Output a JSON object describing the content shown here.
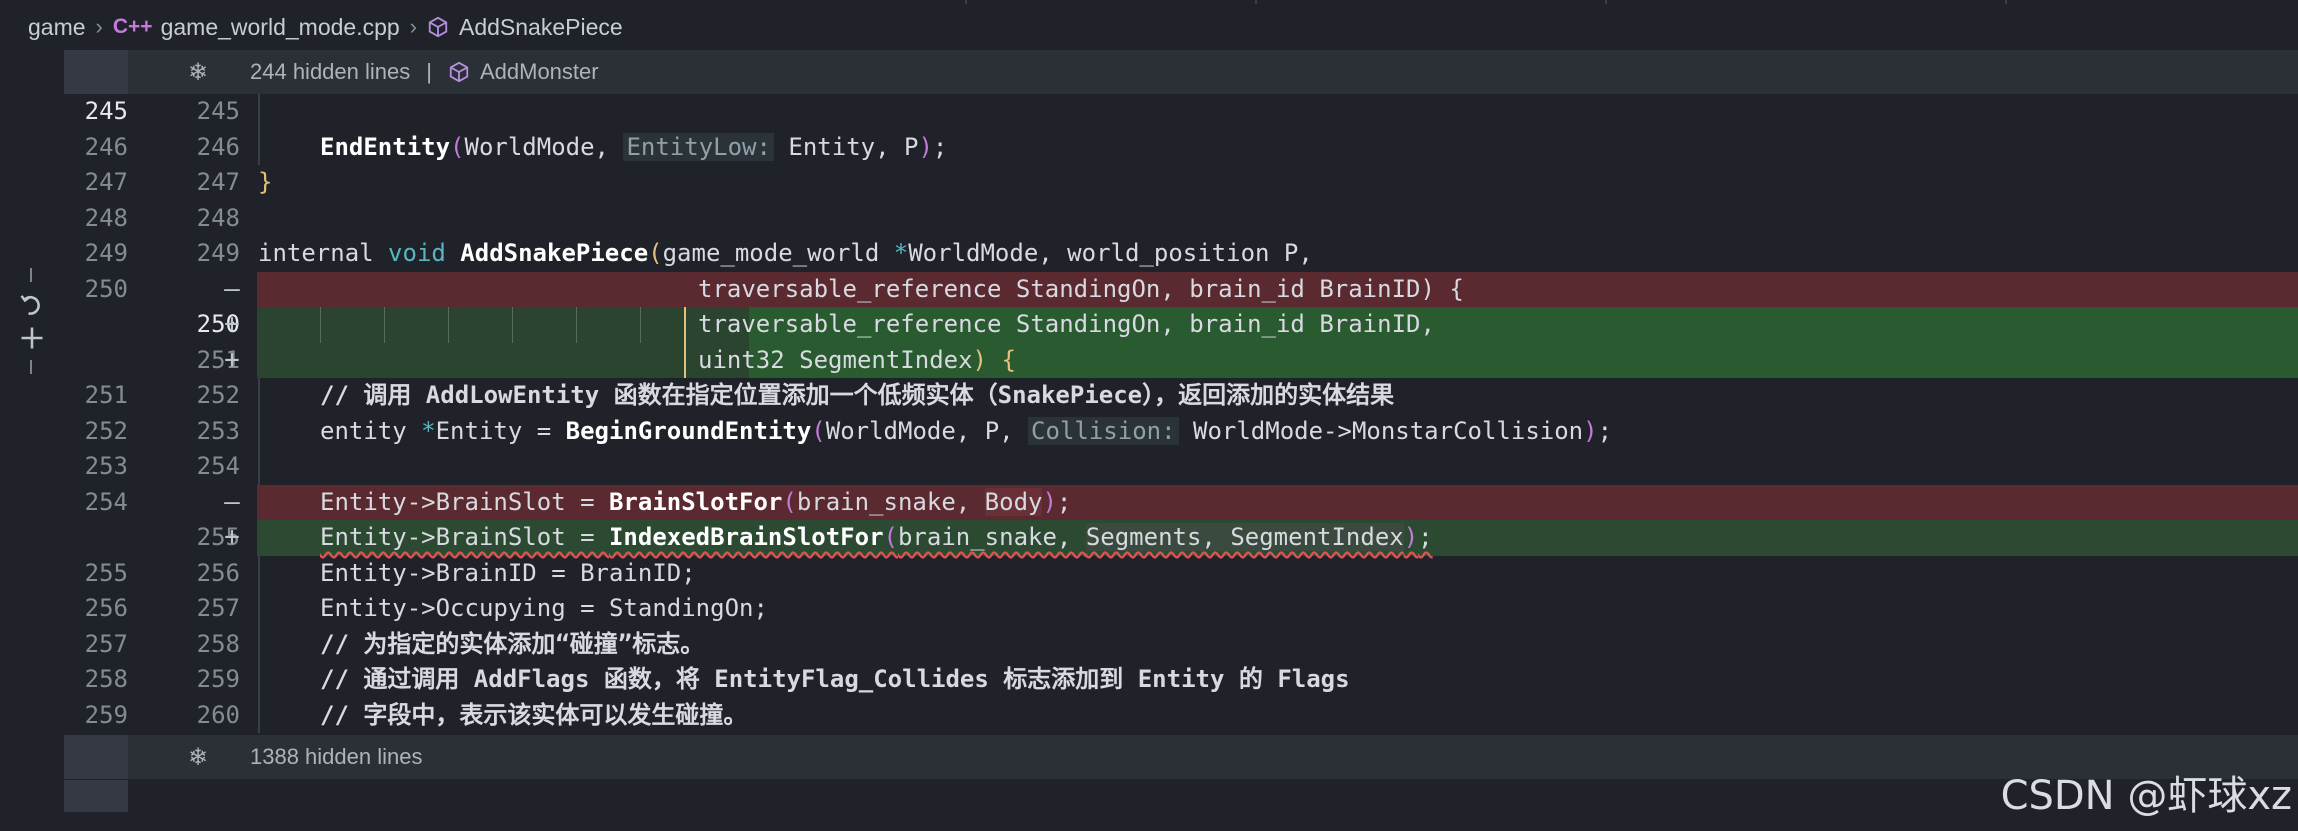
{
  "breadcrumb": {
    "folder": "game",
    "file_badge": "C++",
    "file": "game_world_mode.cpp",
    "symbol": "AddSnakePiece"
  },
  "fold_top": {
    "count": "244 hidden lines",
    "separator": "|",
    "symbol": "AddMonster"
  },
  "fold_bottom": {
    "count": "1388 hidden lines"
  },
  "lines": [
    {
      "old": "245",
      "new": "245",
      "type": "context",
      "active": true
    },
    {
      "old": "246",
      "new": "246",
      "type": "context"
    },
    {
      "old": "247",
      "new": "247",
      "type": "context"
    },
    {
      "old": "248",
      "new": "248",
      "type": "context"
    },
    {
      "old": "249",
      "new": "249",
      "type": "context"
    },
    {
      "old": "250",
      "new": "",
      "type": "removed",
      "marker": "—"
    },
    {
      "old": "",
      "new": "250",
      "type": "added",
      "marker": "+"
    },
    {
      "old": "",
      "new": "251",
      "type": "added",
      "marker": "+"
    },
    {
      "old": "251",
      "new": "252",
      "type": "context"
    },
    {
      "old": "252",
      "new": "253",
      "type": "context"
    },
    {
      "old": "253",
      "new": "254",
      "type": "context"
    },
    {
      "old": "254",
      "new": "",
      "type": "removed",
      "marker": "—"
    },
    {
      "old": "",
      "new": "255",
      "type": "added",
      "marker": "+"
    },
    {
      "old": "255",
      "new": "256",
      "type": "context"
    },
    {
      "old": "256",
      "new": "257",
      "type": "context"
    },
    {
      "old": "257",
      "new": "258",
      "type": "context"
    },
    {
      "old": "258",
      "new": "259",
      "type": "context"
    },
    {
      "old": "259",
      "new": "260",
      "type": "context"
    }
  ],
  "code": {
    "l246_fn": "EndEntity",
    "l246_a": "WorldMode, ",
    "l246_hint": "EntityLow:",
    "l246_b": " Entity, P",
    "l247": "}",
    "l249_kw": "internal",
    "l249_void": "void",
    "l249_fn": "AddSnakePiece",
    "l249_a": "game_mode_world ",
    "l249_ptr": "*",
    "l249_b": "WorldMode, world_position P,",
    "l250_removed": "traversable_reference StandingOn, brain_id BrainID) {",
    "l250_added": "traversable_reference StandingOn, brain_id BrainID,",
    "l251_added_a": "uint32 SegmentIndex",
    "l251_added_b": " {",
    "l252_comment": "// 调用 AddLowEntity 函数在指定位置添加一个低频实体（SnakePiece），返回添加的实体结果",
    "l253_a": "entity ",
    "l253_ptr": "*",
    "l253_b": "Entity = ",
    "l253_fn": "BeginGroundEntity",
    "l253_c": "WorldMode, P, ",
    "l253_hint": "Collision:",
    "l253_d": " WorldMode->MonstarCollision",
    "l254_removed_a": "Entity->BrainSlot = ",
    "l254_removed_fn": "BrainSlotFor",
    "l254_removed_b": "brain_snake, ",
    "l254_removed_w": "Body",
    "l255_added_a": "Entity->BrainSlot = ",
    "l255_added_fn": "IndexedBrainSlotFor",
    "l255_added_b": "brain_snake, ",
    "l255_added_w1": "Segments, SegmentIndex",
    "l256": "Entity->BrainID = BrainID;",
    "l257": "Entity->Occupying = StandingOn;",
    "l258_comment": "// 为指定的实体添加“碰撞”标志。",
    "l259_comment": "// 通过调用 AddFlags 函数，将 EntityFlag_Collides 标志添加到 Entity 的 Flags",
    "l260_comment": "// 字段中，表示该实体可以发生碰撞。"
  },
  "watermark": "CSDN @虾球xz",
  "icons": {
    "fold": "unfold-icon",
    "symbol": "cube-icon",
    "revert": "revert-icon",
    "stage": "plus-icon"
  },
  "colors": {
    "background": "#1f2228",
    "removed": "#5a2a30",
    "added": "#2a5a30",
    "function": "#ffffff",
    "keyword_void": "#56b6c2",
    "bracket": "#c678dd",
    "bracket_alt": "#e5c07b"
  }
}
